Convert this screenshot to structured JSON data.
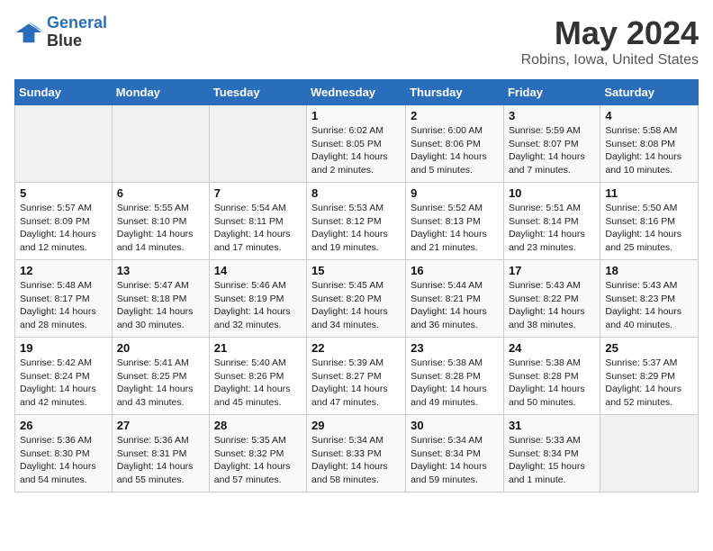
{
  "header": {
    "logo_line1": "General",
    "logo_line2": "Blue",
    "month": "May 2024",
    "location": "Robins, Iowa, United States"
  },
  "weekdays": [
    "Sunday",
    "Monday",
    "Tuesday",
    "Wednesday",
    "Thursday",
    "Friday",
    "Saturday"
  ],
  "weeks": [
    [
      {
        "day": "",
        "info": ""
      },
      {
        "day": "",
        "info": ""
      },
      {
        "day": "",
        "info": ""
      },
      {
        "day": "1",
        "info": "Sunrise: 6:02 AM\nSunset: 8:05 PM\nDaylight: 14 hours\nand 2 minutes."
      },
      {
        "day": "2",
        "info": "Sunrise: 6:00 AM\nSunset: 8:06 PM\nDaylight: 14 hours\nand 5 minutes."
      },
      {
        "day": "3",
        "info": "Sunrise: 5:59 AM\nSunset: 8:07 PM\nDaylight: 14 hours\nand 7 minutes."
      },
      {
        "day": "4",
        "info": "Sunrise: 5:58 AM\nSunset: 8:08 PM\nDaylight: 14 hours\nand 10 minutes."
      }
    ],
    [
      {
        "day": "5",
        "info": "Sunrise: 5:57 AM\nSunset: 8:09 PM\nDaylight: 14 hours\nand 12 minutes."
      },
      {
        "day": "6",
        "info": "Sunrise: 5:55 AM\nSunset: 8:10 PM\nDaylight: 14 hours\nand 14 minutes."
      },
      {
        "day": "7",
        "info": "Sunrise: 5:54 AM\nSunset: 8:11 PM\nDaylight: 14 hours\nand 17 minutes."
      },
      {
        "day": "8",
        "info": "Sunrise: 5:53 AM\nSunset: 8:12 PM\nDaylight: 14 hours\nand 19 minutes."
      },
      {
        "day": "9",
        "info": "Sunrise: 5:52 AM\nSunset: 8:13 PM\nDaylight: 14 hours\nand 21 minutes."
      },
      {
        "day": "10",
        "info": "Sunrise: 5:51 AM\nSunset: 8:14 PM\nDaylight: 14 hours\nand 23 minutes."
      },
      {
        "day": "11",
        "info": "Sunrise: 5:50 AM\nSunset: 8:16 PM\nDaylight: 14 hours\nand 25 minutes."
      }
    ],
    [
      {
        "day": "12",
        "info": "Sunrise: 5:48 AM\nSunset: 8:17 PM\nDaylight: 14 hours\nand 28 minutes."
      },
      {
        "day": "13",
        "info": "Sunrise: 5:47 AM\nSunset: 8:18 PM\nDaylight: 14 hours\nand 30 minutes."
      },
      {
        "day": "14",
        "info": "Sunrise: 5:46 AM\nSunset: 8:19 PM\nDaylight: 14 hours\nand 32 minutes."
      },
      {
        "day": "15",
        "info": "Sunrise: 5:45 AM\nSunset: 8:20 PM\nDaylight: 14 hours\nand 34 minutes."
      },
      {
        "day": "16",
        "info": "Sunrise: 5:44 AM\nSunset: 8:21 PM\nDaylight: 14 hours\nand 36 minutes."
      },
      {
        "day": "17",
        "info": "Sunrise: 5:43 AM\nSunset: 8:22 PM\nDaylight: 14 hours\nand 38 minutes."
      },
      {
        "day": "18",
        "info": "Sunrise: 5:43 AM\nSunset: 8:23 PM\nDaylight: 14 hours\nand 40 minutes."
      }
    ],
    [
      {
        "day": "19",
        "info": "Sunrise: 5:42 AM\nSunset: 8:24 PM\nDaylight: 14 hours\nand 42 minutes."
      },
      {
        "day": "20",
        "info": "Sunrise: 5:41 AM\nSunset: 8:25 PM\nDaylight: 14 hours\nand 43 minutes."
      },
      {
        "day": "21",
        "info": "Sunrise: 5:40 AM\nSunset: 8:26 PM\nDaylight: 14 hours\nand 45 minutes."
      },
      {
        "day": "22",
        "info": "Sunrise: 5:39 AM\nSunset: 8:27 PM\nDaylight: 14 hours\nand 47 minutes."
      },
      {
        "day": "23",
        "info": "Sunrise: 5:38 AM\nSunset: 8:28 PM\nDaylight: 14 hours\nand 49 minutes."
      },
      {
        "day": "24",
        "info": "Sunrise: 5:38 AM\nSunset: 8:28 PM\nDaylight: 14 hours\nand 50 minutes."
      },
      {
        "day": "25",
        "info": "Sunrise: 5:37 AM\nSunset: 8:29 PM\nDaylight: 14 hours\nand 52 minutes."
      }
    ],
    [
      {
        "day": "26",
        "info": "Sunrise: 5:36 AM\nSunset: 8:30 PM\nDaylight: 14 hours\nand 54 minutes."
      },
      {
        "day": "27",
        "info": "Sunrise: 5:36 AM\nSunset: 8:31 PM\nDaylight: 14 hours\nand 55 minutes."
      },
      {
        "day": "28",
        "info": "Sunrise: 5:35 AM\nSunset: 8:32 PM\nDaylight: 14 hours\nand 57 minutes."
      },
      {
        "day": "29",
        "info": "Sunrise: 5:34 AM\nSunset: 8:33 PM\nDaylight: 14 hours\nand 58 minutes."
      },
      {
        "day": "30",
        "info": "Sunrise: 5:34 AM\nSunset: 8:34 PM\nDaylight: 14 hours\nand 59 minutes."
      },
      {
        "day": "31",
        "info": "Sunrise: 5:33 AM\nSunset: 8:34 PM\nDaylight: 15 hours\nand 1 minute."
      },
      {
        "day": "",
        "info": ""
      }
    ]
  ]
}
